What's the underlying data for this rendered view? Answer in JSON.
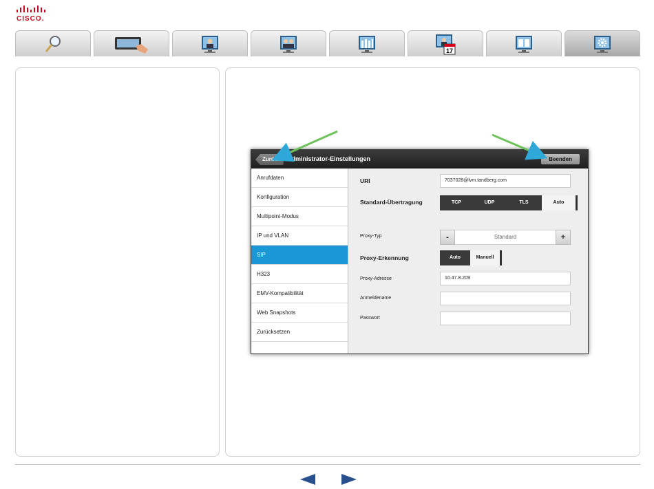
{
  "brand": {
    "logo_text": "CISCO.",
    "color": "#d0021b"
  },
  "tabs": [
    {
      "icon": "search-magnifier-icon",
      "active": false
    },
    {
      "icon": "touch-panel-icon",
      "active": false
    },
    {
      "icon": "person-monitor-icon",
      "active": false
    },
    {
      "icon": "multi-person-monitor-icon",
      "active": false
    },
    {
      "icon": "audience-monitor-icon",
      "active": false
    },
    {
      "icon": "calendar-monitor-icon",
      "active": false,
      "badge": "17"
    },
    {
      "icon": "book-monitor-icon",
      "active": false
    },
    {
      "icon": "gear-monitor-icon",
      "active": true
    }
  ],
  "device": {
    "header": {
      "back_label": "Zurück",
      "title": "Administrator-Einstellungen",
      "end_label": "Beenden"
    },
    "menu": [
      {
        "label": "Anrufdaten",
        "selected": false
      },
      {
        "label": "Konfiguration",
        "selected": false
      },
      {
        "label": "Multipoint-Modus",
        "selected": false
      },
      {
        "label": "IP und VLAN",
        "selected": false
      },
      {
        "label": "SIP",
        "selected": true
      },
      {
        "label": "H323",
        "selected": false
      },
      {
        "label": "EMV-Kompatibilität",
        "selected": false
      },
      {
        "label": "Web Snapshots",
        "selected": false
      },
      {
        "label": "Zurücksetzen",
        "selected": false
      }
    ],
    "settings": {
      "uri_label": "URI",
      "uri_value": "7037028@lvm.tandberg.com",
      "transport_label": "Standard-Übertragung",
      "transport_options": [
        "TCP",
        "UDP",
        "TLS",
        "Auto"
      ],
      "transport_selected": "Auto",
      "proxy_type_label": "Proxy-Typ",
      "proxy_type_minus": "-",
      "proxy_type_value": "Standard",
      "proxy_type_plus": "+",
      "discovery_label": "Proxy-Erkennung",
      "discovery_options": [
        "Auto",
        "Manuell"
      ],
      "discovery_selected": "Manuell",
      "proxy_address_label": "Proxy-Adresse",
      "proxy_address_value": "10.47.8.209",
      "login_label": "Anmeldename",
      "login_value": "",
      "password_label": "Passwort",
      "password_value": ""
    }
  },
  "colors": {
    "selected_menu": "#1a98d5",
    "arrow": "#6dc35a"
  },
  "nav": {
    "prev_icon": "previous-arrow-icon",
    "next_icon": "next-arrow-icon"
  }
}
